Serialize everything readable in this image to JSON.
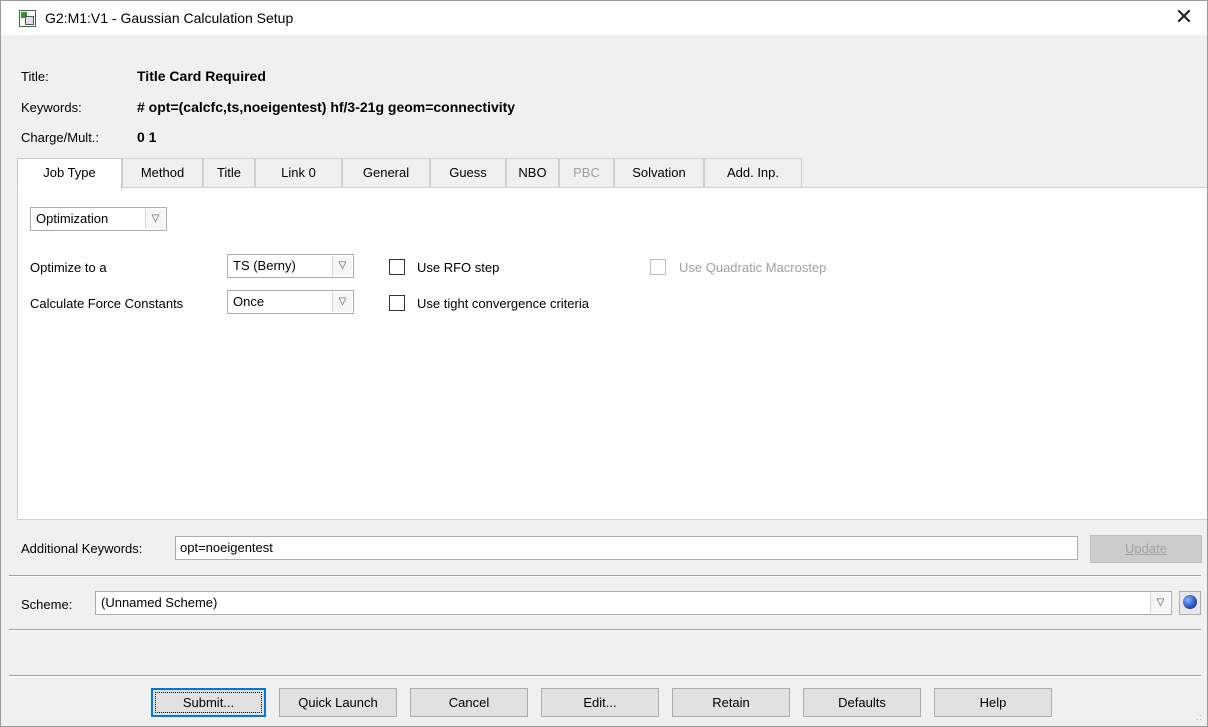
{
  "window": {
    "title": "G2:M1:V1 - Gaussian Calculation Setup",
    "close_label": "✕"
  },
  "header": {
    "title_label": "Title:",
    "title_value": "Title Card Required",
    "keywords_label": "Keywords:",
    "keywords_value": "# opt=(calcfc,ts,noeigentest) hf/3-21g geom=connectivity",
    "charge_label": "Charge/Mult.:",
    "charge_value": "0 1"
  },
  "tabs": [
    {
      "label": "Job Type",
      "active": true
    },
    {
      "label": "Method"
    },
    {
      "label": "Title"
    },
    {
      "label": "Link 0"
    },
    {
      "label": "General"
    },
    {
      "label": "Guess"
    },
    {
      "label": "NBO"
    },
    {
      "label": "PBC",
      "disabled": true
    },
    {
      "label": "Solvation"
    },
    {
      "label": "Add. Inp."
    }
  ],
  "job": {
    "job_type_value": "Optimization",
    "optimize_label": "Optimize to a",
    "optimize_value": "TS (Berny)",
    "force_label": "Calculate Force Constants",
    "force_value": "Once",
    "rfo_label": "Use RFO step",
    "tight_label": "Use tight convergence criteria",
    "quadratic_label": "Use Quadratic Macrostep"
  },
  "additional": {
    "label": "Additional Keywords:",
    "value": "opt=noeigentest",
    "update_label": "Update"
  },
  "scheme": {
    "label": "Scheme:",
    "value": "(Unnamed Scheme)"
  },
  "buttons": {
    "submit": "Submit...",
    "quick_launch": "Quick Launch",
    "cancel": "Cancel",
    "edit": "Edit...",
    "retain": "Retain",
    "defaults": "Defaults",
    "help": "Help"
  },
  "colors": {
    "focus_border": "#0078d7",
    "disabled_text": "#a0a0a0",
    "panel_bg": "#f0f0f0"
  }
}
